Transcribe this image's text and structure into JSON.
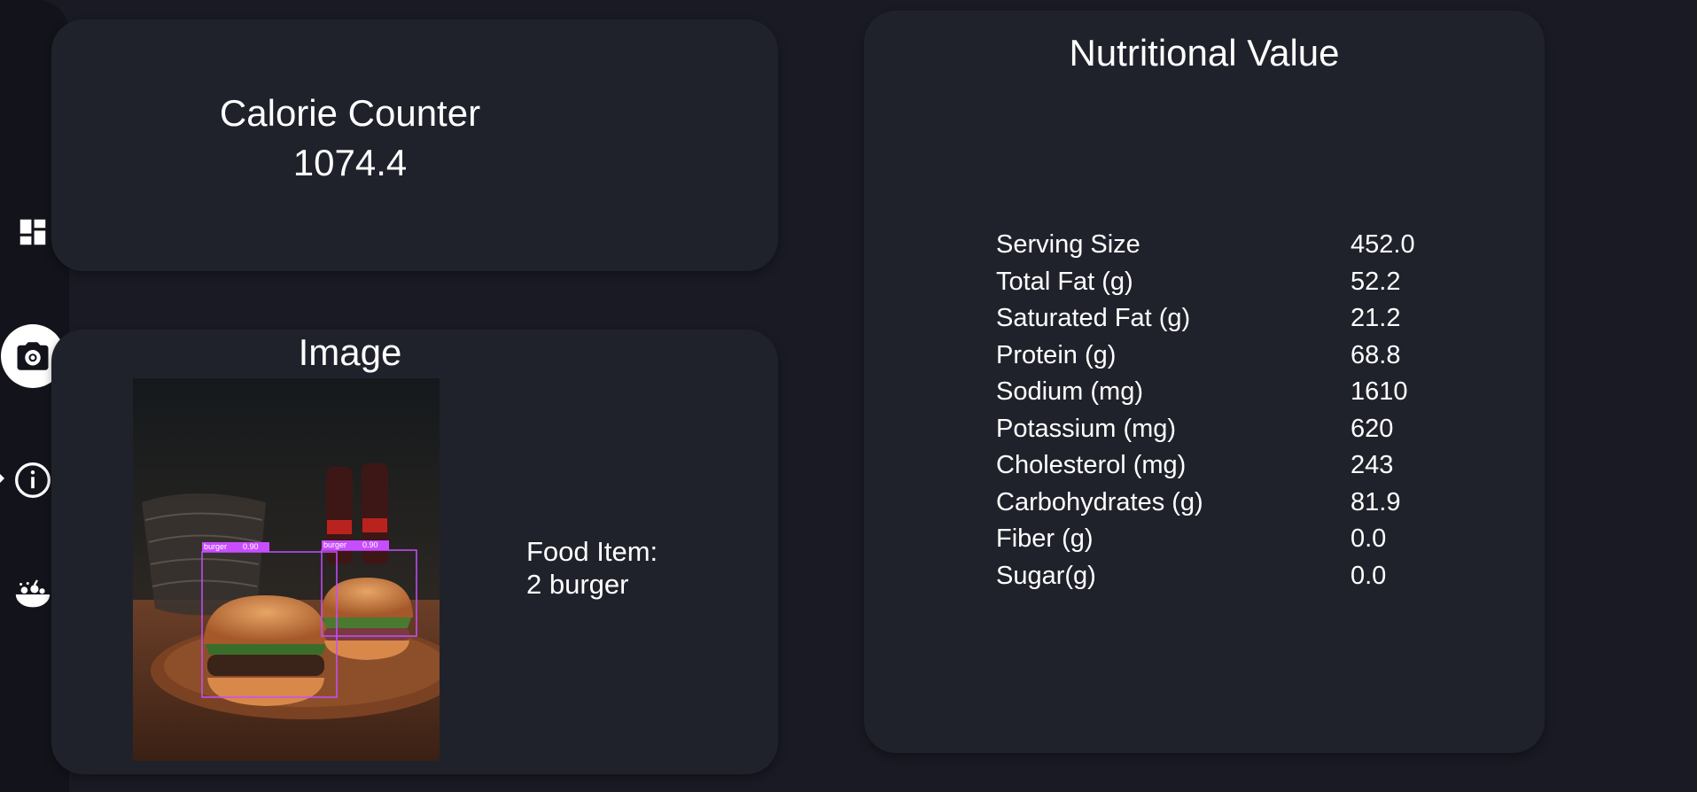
{
  "sidebar": {
    "items": [
      {
        "icon": "dashboard-icon",
        "active": false
      },
      {
        "icon": "camera-icon",
        "active": true
      },
      {
        "icon": "info-icon",
        "active": false
      },
      {
        "icon": "fruit-bowl-icon",
        "active": false
      }
    ]
  },
  "calorie_card": {
    "title": "Calorie Counter",
    "value": "1074.4"
  },
  "image_card": {
    "title": "Image",
    "detections": [
      {
        "label": "burger",
        "score": "0.90"
      },
      {
        "label": "burger",
        "score": "0.90"
      }
    ],
    "food_item_label": "Food Item:",
    "food_item_value": "2 burger"
  },
  "nutrition_card": {
    "title": "Nutritional Value",
    "rows": [
      {
        "label": "Serving Size",
        "value": "452.0"
      },
      {
        "label": "Total Fat (g)",
        "value": "52.2"
      },
      {
        "label": "Saturated Fat (g)",
        "value": "21.2"
      },
      {
        "label": "Protein (g)",
        "value": "68.8"
      },
      {
        "label": "Sodium (mg)",
        "value": "1610"
      },
      {
        "label": "Potassium (mg)",
        "value": "620"
      },
      {
        "label": "Cholesterol (mg)",
        "value": "243"
      },
      {
        "label": "Carbohydrates (g)",
        "value": "81.9"
      },
      {
        "label": "Fiber (g)",
        "value": "0.0"
      },
      {
        "label": "Sugar(g)",
        "value": "0.0"
      }
    ]
  },
  "colors": {
    "background": "#1a1a24",
    "card": "#20222b",
    "sidebar": "#13131b",
    "detection_box": "#c84dff"
  }
}
